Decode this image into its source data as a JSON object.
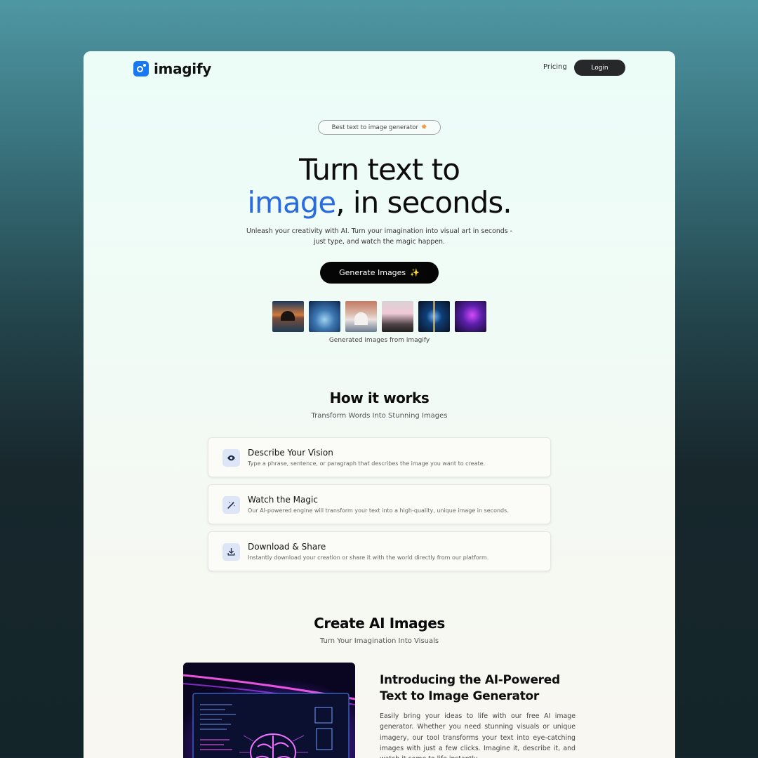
{
  "brand": {
    "name": "imagify"
  },
  "nav": {
    "pricing": "Pricing",
    "login": "Login"
  },
  "hero": {
    "badge": "Best text to image generator",
    "title_line1": "Turn text to",
    "title_highlight": "image",
    "title_rest": ", in seconds.",
    "subtitle": "Unleash your creativity with AI. Turn your imagination into visual art in seconds - just type, and watch the magic happen.",
    "cta": "Generate Images",
    "thumbs_caption": "Generated images from imagify"
  },
  "how": {
    "title": "How it works",
    "subtitle": "Transform Words Into Stunning Images",
    "steps": [
      {
        "title": "Describe Your Vision",
        "desc": "Type a phrase, sentence, or paragraph that describes the image you want to create.",
        "icon": "eye-icon"
      },
      {
        "title": "Watch the Magic",
        "desc": "Our AI-powered engine will transform your text into a high-quality, unique image in seconds.",
        "icon": "magic-wand-icon"
      },
      {
        "title": "Download & Share",
        "desc": "Instantly download your creation or share it with the world directly from our platform.",
        "icon": "download-icon"
      }
    ]
  },
  "create": {
    "title": "Create AI Images",
    "subtitle": "Turn Your Imagination Into Visuals",
    "feature_title": "Introducing the AI-Powered Text to Image Generator",
    "feature_body": "Easily bring your ideas to life with our free AI image generator. Whether you need stunning visuals or unique imagery, our tool transforms your text into eye-catching images with just a few clicks. Imagine it, describe it, and watch it come to life instantly."
  },
  "colors": {
    "accent": "#2a6cdf",
    "brand": "#1877f2",
    "button": "#050505"
  }
}
